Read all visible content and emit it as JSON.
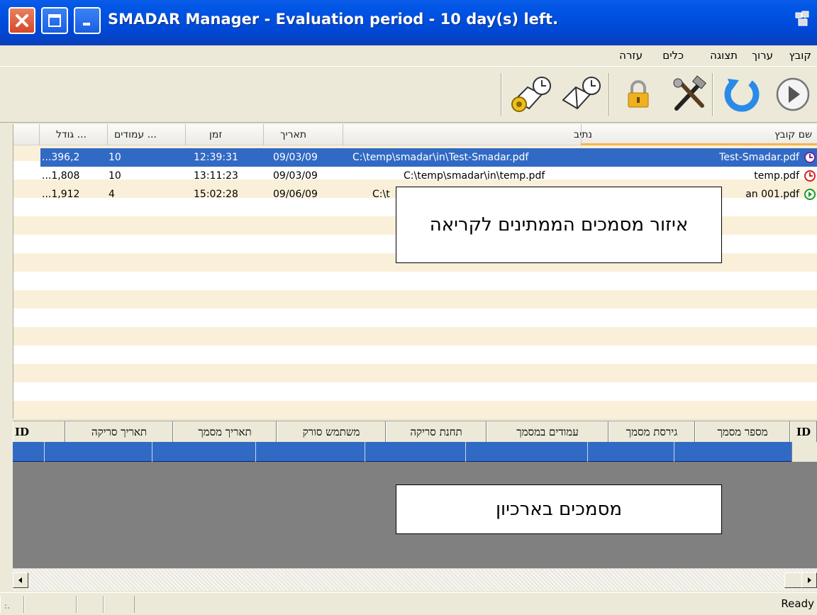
{
  "window": {
    "title": "SMADAR Manager - Evaluation period - 10 day(s) left."
  },
  "menu": {
    "items": [
      "קובץ",
      "ערוך",
      "תצוגה",
      "כלים",
      "עזרה"
    ]
  },
  "toolbar": {
    "tools": [
      "play-icon",
      "refresh-icon",
      "tools-icon",
      "lock-icon",
      "schedule-read-icon",
      "schedule-settings-icon"
    ]
  },
  "upper_table": {
    "columns": [
      "שם קובץ",
      "נתיב",
      "תאריך",
      "זמן",
      "עמודים ...",
      "גודל ..."
    ],
    "rows": [
      {
        "name": "Test-Smadar.pdf",
        "path": "C:\\temp\\smadar\\in\\Test-Smadar.pdf",
        "date": "09/03/09",
        "time": "12:39:31",
        "pages": "10",
        "size": "...396,2",
        "status_icon": "clock-icon"
      },
      {
        "name": "temp.pdf",
        "path": "C:\\temp\\smadar\\in\\temp.pdf",
        "date": "09/03/09",
        "time": "13:11:23",
        "pages": "10",
        "size": "...1,808",
        "status_icon": "clock-icon"
      },
      {
        "name": "an 001.pdf",
        "path": "C:\\t",
        "date": "09/06/09",
        "time": "15:02:28",
        "pages": "4",
        "size": "...1,912",
        "status_icon": "play-circle-icon"
      }
    ]
  },
  "callouts": {
    "pending": "איזור מסמכים הממתינים לקריאה",
    "archive": "מסמכים בארכיון"
  },
  "lower_table": {
    "columns": [
      "ID",
      "מספר מסמך",
      "גירסת מסמך",
      "עמודים במסמך",
      "תחנת סריקה",
      "משתמש סורק",
      "תאריך מסמך",
      "תאריך סריקה",
      "ID"
    ]
  },
  "status": {
    "text": "Ready"
  },
  "colors": {
    "selection": "#316ac5",
    "titlebar": "#0055e5",
    "header_underline": "#f7b548"
  }
}
